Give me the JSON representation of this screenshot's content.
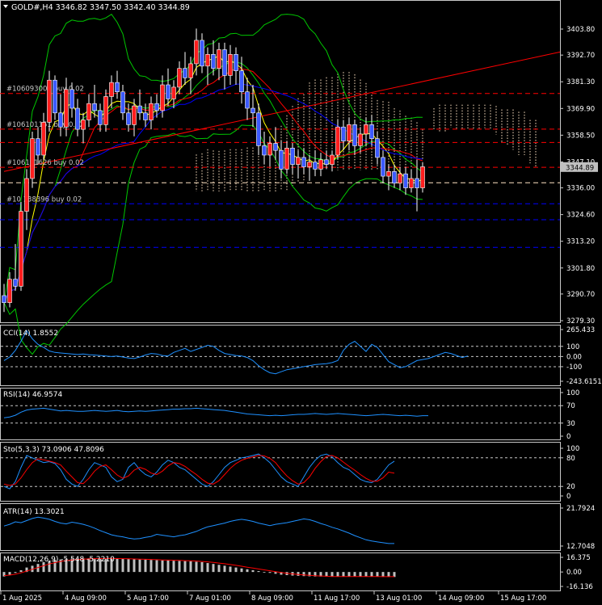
{
  "colors": {
    "background": "#000000",
    "border": "#c8c8c8",
    "text": "#ffffff",
    "bull": "#ff1e1e",
    "bear": "#3c5aff",
    "price_tag": "#c0c0c0",
    "bb": "#00c800",
    "ma_fast": "#ffff00",
    "ma_red": "#ff0000",
    "ma_blue": "#0000ff",
    "cloud": "#ffe4c4",
    "order_red": "#ff0000",
    "order_blue": "#0000ff",
    "indicator": "#1e90ff",
    "signal": "#ff0000",
    "macd_hist": "#c0c0c0",
    "grid": "#c8c8c8"
  },
  "header": {
    "arrow_icon": "triangle-down-icon",
    "text": "GOLD#,H4  3346.82 3347.50 3342.40 3344.89"
  },
  "orders": [
    {
      "label": "#106093005 buy 0.02",
      "price": 3376.3,
      "style": "red"
    },
    {
      "label": "#106101151 buy 0.02",
      "price": 3361.1,
      "style": "red"
    },
    {
      "label": "#106111626 buy 0.02",
      "price": 3344.8,
      "style": "red"
    },
    {
      "label": "#10 138396 buy 0.02",
      "price": 3329.2,
      "style": "blue"
    }
  ],
  "extra_levels": [
    {
      "price": 3355.4,
      "style": "red"
    },
    {
      "price": 3338.2,
      "style": "tan"
    },
    {
      "price": 3322.4,
      "style": "blue"
    },
    {
      "price": 3310.6,
      "style": "blue"
    }
  ],
  "chart_data": {
    "type": "candlestick",
    "symbol": "GOLD#",
    "timeframe": "H4",
    "ohlc_last": {
      "open": 3346.82,
      "high": 3347.5,
      "low": 3342.4,
      "close": 3344.89
    },
    "current_price": "3344.89",
    "price_axis": {
      "ticks": [
        "3403.80",
        "3392.70",
        "3381.30",
        "3369.90",
        "3358.50",
        "3347.10",
        "3336.00",
        "3324.60",
        "3313.20",
        "3301.80",
        "3290.70",
        "3279.30"
      ],
      "ylim": [
        3279.3,
        3403.8
      ]
    },
    "time_axis": {
      "labels": [
        "1 Aug 2025",
        "4 Aug 09:00",
        "5 Aug 17:00",
        "7 Aug 01:00",
        "8 Aug 09:00",
        "11 Aug 17:00",
        "13 Aug 01:00",
        "14 Aug 09:00",
        "15 Aug 17:00"
      ],
      "label_bar_index": [
        0,
        11,
        22,
        33,
        44,
        55,
        66,
        77,
        88
      ]
    },
    "candles": [
      [
        3290,
        3295,
        3283,
        3287
      ],
      [
        3287,
        3300,
        3285,
        3297
      ],
      [
        3297,
        3312,
        3292,
        3294
      ],
      [
        3294,
        3330,
        3292,
        3326
      ],
      [
        3326,
        3344,
        3318,
        3340
      ],
      [
        3340,
        3360,
        3336,
        3357
      ],
      [
        3357,
        3362,
        3346,
        3350
      ],
      [
        3350,
        3368,
        3348,
        3364
      ],
      [
        3364,
        3386,
        3360,
        3382
      ],
      [
        3382,
        3384,
        3365,
        3368
      ],
      [
        3368,
        3376,
        3358,
        3362
      ],
      [
        3362,
        3383,
        3358,
        3378
      ],
      [
        3378,
        3381,
        3366,
        3370
      ],
      [
        3370,
        3374,
        3358,
        3361
      ],
      [
        3361,
        3368,
        3355,
        3365
      ],
      [
        3365,
        3376,
        3362,
        3372
      ],
      [
        3372,
        3380,
        3366,
        3369
      ],
      [
        3369,
        3372,
        3360,
        3363
      ],
      [
        3363,
        3378,
        3360,
        3375
      ],
      [
        3375,
        3384,
        3370,
        3381
      ],
      [
        3381,
        3386,
        3374,
        3377
      ],
      [
        3377,
        3380,
        3365,
        3368
      ],
      [
        3368,
        3372,
        3360,
        3363
      ],
      [
        3363,
        3374,
        3358,
        3371
      ],
      [
        3371,
        3378,
        3365,
        3368
      ],
      [
        3368,
        3372,
        3362,
        3365
      ],
      [
        3365,
        3375,
        3361,
        3372
      ],
      [
        3372,
        3376,
        3366,
        3369
      ],
      [
        3369,
        3384,
        3366,
        3380
      ],
      [
        3380,
        3387,
        3371,
        3374
      ],
      [
        3374,
        3382,
        3370,
        3379
      ],
      [
        3379,
        3390,
        3376,
        3387
      ],
      [
        3387,
        3394,
        3380,
        3383
      ],
      [
        3383,
        3392,
        3376,
        3389
      ],
      [
        3389,
        3404,
        3384,
        3399
      ],
      [
        3399,
        3402,
        3385,
        3388
      ],
      [
        3388,
        3396,
        3380,
        3393
      ],
      [
        3393,
        3399,
        3384,
        3387
      ],
      [
        3387,
        3398,
        3382,
        3395
      ],
      [
        3395,
        3398,
        3378,
        3384
      ],
      [
        3384,
        3397,
        3380,
        3393
      ],
      [
        3393,
        3396,
        3380,
        3386
      ],
      [
        3386,
        3392,
        3372,
        3377
      ],
      [
        3377,
        3383,
        3365,
        3370
      ],
      [
        3370,
        3380,
        3362,
        3368
      ],
      [
        3368,
        3372,
        3350,
        3354
      ],
      [
        3354,
        3360,
        3346,
        3350
      ],
      [
        3350,
        3358,
        3345,
        3355
      ],
      [
        3355,
        3362,
        3348,
        3352
      ],
      [
        3352,
        3356,
        3340,
        3344
      ],
      [
        3344,
        3356,
        3342,
        3353
      ],
      [
        3353,
        3355,
        3342,
        3346
      ],
      [
        3346,
        3352,
        3340,
        3349
      ],
      [
        3349,
        3353,
        3342,
        3345
      ],
      [
        3345,
        3350,
        3339,
        3347
      ],
      [
        3347,
        3352,
        3341,
        3344
      ],
      [
        3344,
        3351,
        3341,
        3348
      ],
      [
        3348,
        3352,
        3344,
        3346
      ],
      [
        3346,
        3352,
        3343,
        3350
      ],
      [
        3350,
        3365,
        3348,
        3362
      ],
      [
        3362,
        3365,
        3352,
        3356
      ],
      [
        3356,
        3366,
        3352,
        3363
      ],
      [
        3363,
        3365,
        3350,
        3354
      ],
      [
        3354,
        3362,
        3351,
        3359
      ],
      [
        3359,
        3366,
        3354,
        3363
      ],
      [
        3363,
        3367,
        3354,
        3357
      ],
      [
        3357,
        3360,
        3346,
        3349
      ],
      [
        3349,
        3352,
        3338,
        3341
      ],
      [
        3341,
        3346,
        3335,
        3343
      ],
      [
        3343,
        3346,
        3336,
        3338
      ],
      [
        3338,
        3345,
        3335,
        3342
      ],
      [
        3342,
        3345,
        3333,
        3336
      ],
      [
        3336,
        3344,
        3334,
        3340
      ],
      [
        3340,
        3348,
        3326,
        3336
      ],
      [
        3336,
        3347,
        3334,
        3345
      ]
    ]
  },
  "panels": {
    "cci": {
      "label": "CCI(14) 1.8552",
      "ticks": [
        "265.433",
        "100",
        "0.00",
        "-100",
        "-243.6151"
      ],
      "ylim": [
        -243.6151,
        265.433
      ],
      "levels": [
        100,
        0,
        -100
      ],
      "values": [
        -40,
        -5,
        60,
        150,
        255,
        175,
        120,
        90,
        55,
        40,
        35,
        30,
        25,
        20,
        25,
        18,
        15,
        10,
        5,
        0,
        5,
        -5,
        -15,
        -20,
        -5,
        15,
        30,
        25,
        10,
        5,
        40,
        60,
        80,
        50,
        70,
        90,
        110,
        100,
        60,
        30,
        20,
        10,
        5,
        -10,
        -40,
        -90,
        -130,
        -160,
        -170,
        -150,
        -130,
        -120,
        -110,
        -100,
        -90,
        -80,
        -75,
        -70,
        -60,
        -40,
        60,
        120,
        150,
        100,
        50,
        120,
        90,
        20,
        -50,
        -80,
        -110,
        -100,
        -70,
        -40,
        -30,
        -20,
        0,
        20,
        40,
        30,
        10,
        -10,
        5
      ]
    },
    "rsi": {
      "label": "RSI(14) 46.9574",
      "ticks": [
        "100",
        "70",
        "30",
        "0"
      ],
      "ylim": [
        0,
        100
      ],
      "levels": [
        70,
        30
      ],
      "values": [
        42,
        44,
        48,
        55,
        60,
        62,
        63,
        64,
        62,
        60,
        58,
        59,
        58,
        57,
        57,
        58,
        59,
        58,
        57,
        58,
        59,
        57,
        56,
        57,
        58,
        57,
        58,
        59,
        60,
        61,
        62,
        62,
        63,
        63,
        64,
        63,
        62,
        61,
        60,
        59,
        57,
        55,
        53,
        51,
        50,
        49,
        48,
        47,
        48,
        47,
        48,
        49,
        50,
        50,
        51,
        52,
        51,
        50,
        51,
        52,
        51,
        50,
        49,
        48,
        47,
        48,
        49,
        50,
        49,
        48,
        47,
        48,
        47,
        46,
        47,
        47
      ]
    },
    "stoch": {
      "label": "Sto(5,3,3) 73.0906 47.8096",
      "ticks": [
        "100",
        "80",
        "20",
        "0"
      ],
      "ylim": [
        0,
        100
      ],
      "levels": [
        80,
        20
      ],
      "k": [
        20,
        15,
        30,
        60,
        85,
        80,
        75,
        70,
        72,
        68,
        55,
        35,
        25,
        20,
        35,
        55,
        70,
        65,
        60,
        40,
        30,
        35,
        60,
        70,
        55,
        45,
        40,
        50,
        65,
        75,
        70,
        60,
        55,
        45,
        35,
        25,
        20,
        30,
        45,
        60,
        70,
        75,
        80,
        82,
        85,
        88,
        80,
        70,
        55,
        40,
        30,
        25,
        20,
        40,
        60,
        75,
        85,
        88,
        82,
        70,
        60,
        55,
        45,
        35,
        30,
        28,
        35,
        50,
        65,
        73
      ],
      "d": [
        25,
        22,
        25,
        38,
        55,
        70,
        78,
        76,
        73,
        70,
        65,
        52,
        40,
        28,
        26,
        37,
        52,
        62,
        65,
        55,
        44,
        37,
        42,
        54,
        60,
        56,
        48,
        45,
        52,
        63,
        70,
        68,
        62,
        53,
        45,
        35,
        27,
        25,
        32,
        45,
        58,
        68,
        75,
        79,
        82,
        85,
        84,
        79,
        70,
        55,
        42,
        32,
        25,
        28,
        40,
        58,
        72,
        83,
        85,
        80,
        71,
        62,
        54,
        45,
        37,
        31,
        31,
        38,
        50,
        48
      ]
    },
    "atr": {
      "label": "ATR(14) 13.3021",
      "ticks": [
        "21.7924",
        "12.7048"
      ],
      "ylim": [
        12.7048,
        21.7924
      ],
      "values": [
        17.5,
        17.9,
        18.5,
        18.3,
        18.8,
        19.3,
        19.6,
        19.4,
        19.1,
        18.6,
        18.2,
        18.0,
        18.4,
        18.2,
        17.9,
        17.5,
        17.0,
        16.4,
        15.9,
        15.4,
        15.1,
        14.9,
        14.6,
        14.4,
        14.5,
        14.8,
        15.0,
        15.5,
        15.3,
        15.1,
        14.9,
        15.2,
        15.4,
        15.8,
        16.2,
        16.8,
        17.3,
        17.6,
        17.9,
        18.2,
        18.6,
        18.9,
        19.1,
        18.9,
        18.6,
        18.2,
        17.9,
        17.6,
        17.9,
        18.1,
        18.3,
        18.6,
        18.9,
        19.2,
        19.0,
        18.6,
        18.1,
        17.7,
        17.2,
        16.8,
        16.3,
        15.8,
        15.2,
        14.7,
        14.2,
        13.9,
        13.7,
        13.5,
        13.3,
        13.3
      ]
    },
    "macd": {
      "label": "MACD(12,26,9) -5.548 -5.2210",
      "ticks": [
        "16.375",
        "0.00",
        "-16.136"
      ],
      "ylim": [
        -16.136,
        16.375
      ],
      "hist": [
        -5,
        -3,
        -1,
        2,
        5,
        7,
        9,
        11,
        12.5,
        13.5,
        14,
        14.5,
        14.8,
        15,
        15.2,
        15.3,
        15.3,
        15.2,
        15.1,
        15,
        14.8,
        14.6,
        14.4,
        14.2,
        14,
        13.8,
        13.5,
        13.2,
        13,
        12.8,
        12.6,
        12.4,
        12.2,
        12,
        11.5,
        11,
        10,
        9,
        8,
        7,
        6,
        5,
        4,
        3,
        2,
        1,
        0,
        -1,
        -2,
        -3,
        -3.5,
        -4,
        -4.3,
        -4.6,
        -4.8,
        -5,
        -5.1,
        -5.2,
        -5.2,
        -5.1,
        -5,
        -4.9,
        -4.8,
        -4.9,
        -5,
        -5.2,
        -5.3,
        -5.4,
        -5.5,
        -5.55
      ],
      "signal": [
        -4,
        -3.5,
        -2.5,
        -1,
        1,
        3,
        5,
        7,
        9,
        10.5,
        11.8,
        12.8,
        13.5,
        14,
        14.4,
        14.7,
        14.9,
        15,
        15.1,
        15.1,
        15,
        14.9,
        14.8,
        14.6,
        14.4,
        14.2,
        14,
        13.8,
        13.5,
        13.3,
        13.1,
        12.9,
        12.7,
        12.5,
        12.2,
        11.8,
        11.3,
        10.7,
        10,
        9.2,
        8.3,
        7.4,
        6.4,
        5.4,
        4.4,
        3.4,
        2.4,
        1.4,
        0.4,
        -0.6,
        -1.4,
        -2.1,
        -2.8,
        -3.3,
        -3.8,
        -4.2,
        -4.5,
        -4.8,
        -5,
        -5.1,
        -5.1,
        -5.1,
        -5,
        -5,
        -5,
        -5.1,
        -5.1,
        -5.2,
        -5.2,
        -5.22
      ]
    }
  }
}
